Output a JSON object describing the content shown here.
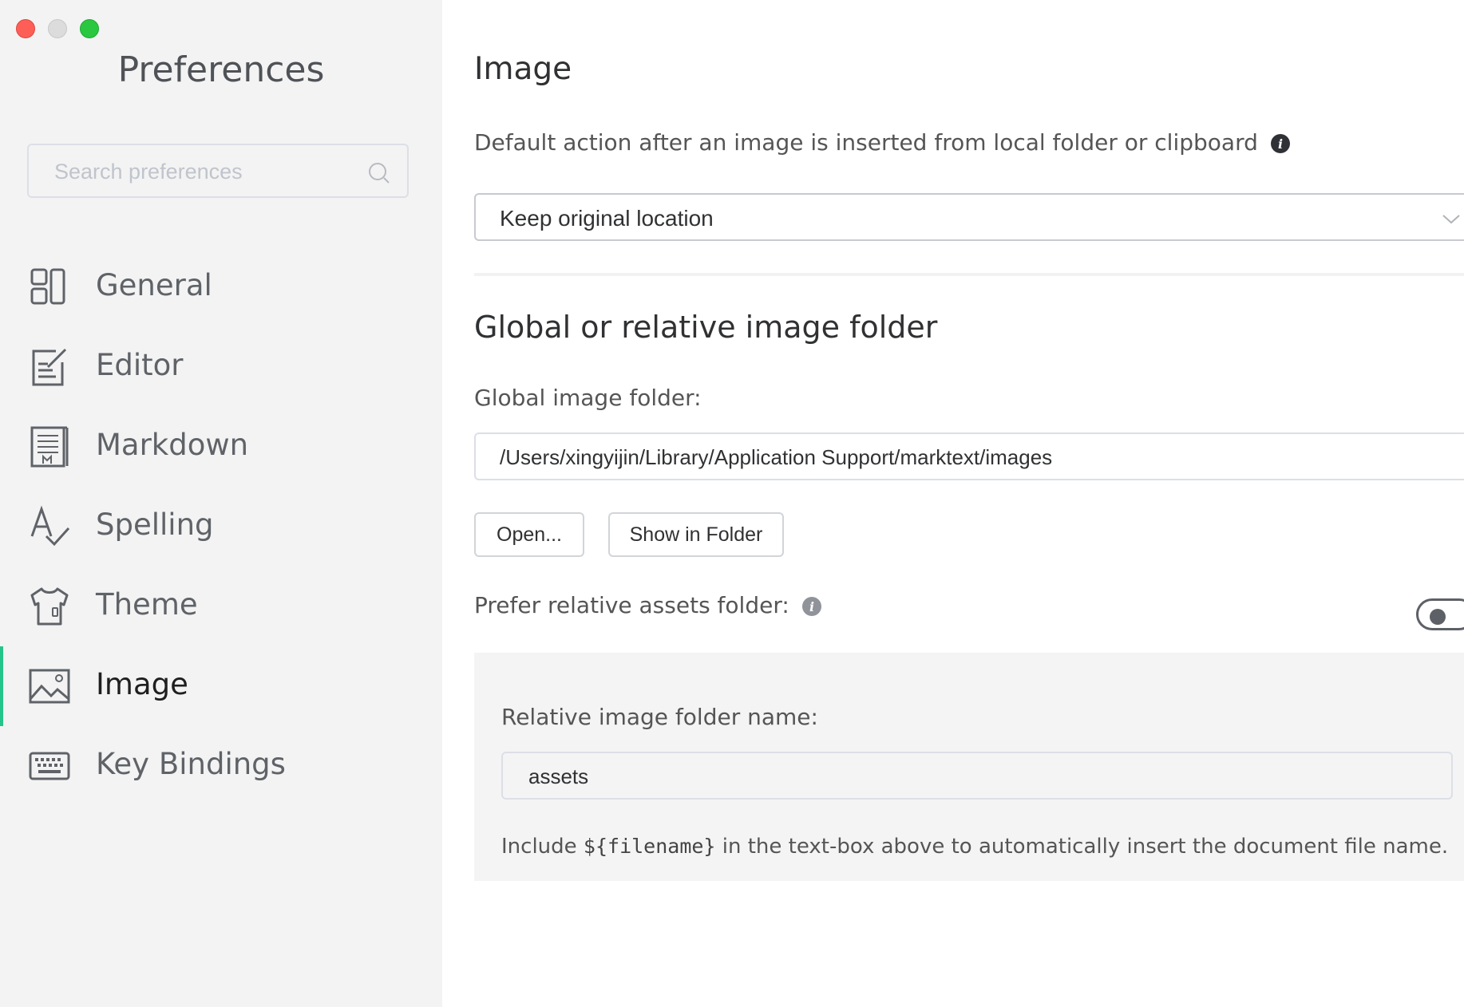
{
  "window": {
    "controls": [
      "close",
      "minimize",
      "maximize"
    ],
    "colors": {
      "close": "#fd5f57",
      "minimize": "#dcdcdc",
      "maximize": "#2ac840"
    }
  },
  "sidebar": {
    "title": "Preferences",
    "search": {
      "placeholder": "Search preferences",
      "value": ""
    },
    "active_accent": "#25c48a",
    "items": [
      {
        "label": "General",
        "icon": "general-icon",
        "active": false
      },
      {
        "label": "Editor",
        "icon": "editor-icon",
        "active": false
      },
      {
        "label": "Markdown",
        "icon": "markdown-icon",
        "active": false
      },
      {
        "label": "Spelling",
        "icon": "spelling-icon",
        "active": false
      },
      {
        "label": "Theme",
        "icon": "theme-icon",
        "active": false
      },
      {
        "label": "Image",
        "icon": "image-icon",
        "active": true
      },
      {
        "label": "Key Bindings",
        "icon": "keyboard-icon",
        "active": false
      }
    ]
  },
  "main": {
    "title": "Image",
    "default_action": {
      "label": "Default action after an image is inserted from local folder or clipboard",
      "selected": "Keep original location"
    },
    "folder_section": {
      "title": "Global or relative image folder",
      "global_label": "Global image folder:",
      "global_path": "/Users/xingyijin/Library/Application Support/marktext/images",
      "open_button": "Open...",
      "show_button": "Show in Folder",
      "prefer_relative_label": "Prefer relative assets folder:",
      "prefer_relative_enabled": false,
      "relative_label": "Relative image folder name:",
      "relative_value": "assets",
      "note_before": "Include ",
      "note_code": "${filename}",
      "note_after": " in the text-box above to automatically insert the document file name."
    }
  }
}
